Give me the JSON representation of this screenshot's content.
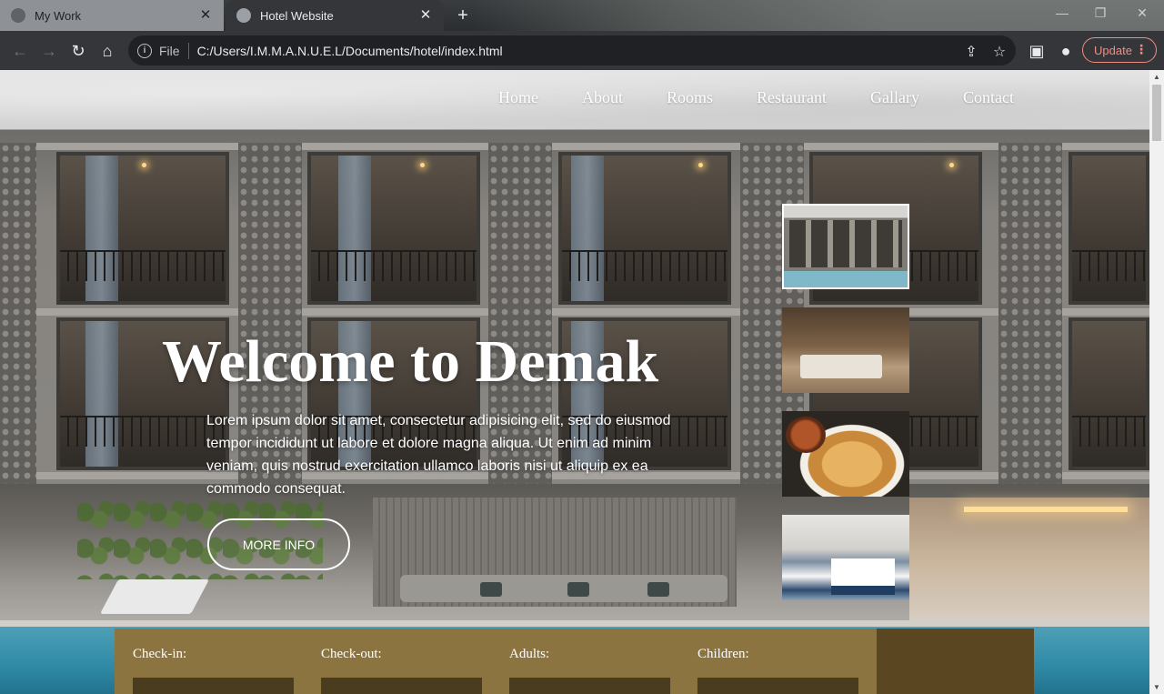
{
  "browser": {
    "tabs": [
      {
        "title": "My Work",
        "active": false
      },
      {
        "title": "Hotel Website",
        "active": true
      }
    ],
    "close_glyph": "✕",
    "new_tab_glyph": "+",
    "address": {
      "scheme_label": "File",
      "url": "C:/Users/I.M.M.A.N.U.E.L/Documents/hotel/index.html"
    },
    "update_button": "Update",
    "icons": [
      "back-icon",
      "forward-icon",
      "reload-icon",
      "home-icon",
      "info-icon",
      "share-icon",
      "star-icon",
      "side-panel-icon",
      "profile-icon",
      "menu-dots-icon"
    ]
  },
  "site": {
    "nav": [
      "Home",
      "About",
      "Rooms",
      "Restaurant",
      "Gallary",
      "Contact"
    ],
    "hero": {
      "headline": "Welcome to Demak",
      "body": "Lorem ipsum dolor sit amet, consectetur adipisicing elit, sed do eiusmod tempor incididunt ut labore et dolore magna aliqua. Ut enim ad minim veniam, quis nostrud exercitation ullamco laboris nisi ut aliquip ex ea commodo consequat.",
      "cta": "MORE INFO"
    },
    "thumbnails": [
      {
        "subject": "hotel exterior with pool",
        "selected": true
      },
      {
        "subject": "bedroom interior",
        "selected": false
      },
      {
        "subject": "waffles and chicken plate",
        "selected": false
      },
      {
        "subject": "blue and white hotel room",
        "selected": false
      }
    ],
    "booking": {
      "fields": [
        "Check-in:",
        "Check-out:",
        "Adults:",
        "Children:"
      ]
    }
  },
  "colors": {
    "booking_bg": "#8c7440",
    "booking_dark": "#5a4620",
    "update_accent": "#f28b82",
    "chrome_toolbar": "#35363a"
  }
}
